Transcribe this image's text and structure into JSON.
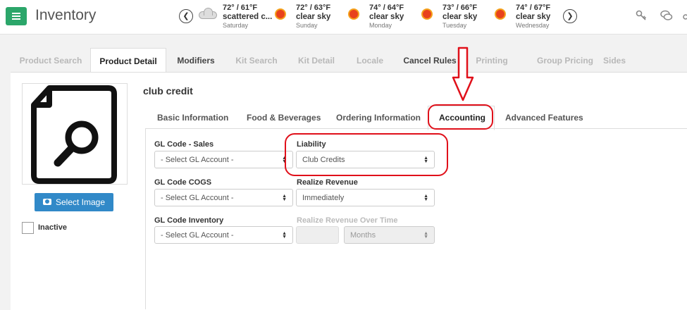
{
  "app": {
    "title": "Inventory"
  },
  "weather": [
    {
      "temp": "72° / 61°F",
      "cond": "scattered c...",
      "day": "Saturday",
      "icon": "cloud-icon"
    },
    {
      "temp": "72° / 63°F",
      "cond": "clear sky",
      "day": "Sunday",
      "icon": "sun-icon"
    },
    {
      "temp": "74° / 64°F",
      "cond": "clear sky",
      "day": "Monday",
      "icon": "sun-icon"
    },
    {
      "temp": "73° / 66°F",
      "cond": "clear sky",
      "day": "Tuesday",
      "icon": "sun-icon"
    },
    {
      "temp": "74° / 67°F",
      "cond": "clear sky",
      "day": "Wednesday",
      "icon": "sun-icon"
    }
  ],
  "tabs": [
    "Product Search",
    "Product Detail",
    "Modifiers",
    "Kit Search",
    "Kit Detail",
    "Locale",
    "Cancel Rules",
    "Printing",
    "Group Pricing",
    "Sides"
  ],
  "image": {
    "button": "Select Image",
    "inactive_label": "Inactive"
  },
  "item": {
    "title": "club credit"
  },
  "subtabs": [
    "Basic Information",
    "Food & Beverages",
    "Ordering Information",
    "Accounting",
    "Advanced Features"
  ],
  "form": {
    "gl_sales": {
      "label": "GL Code - Sales",
      "value": "- Select GL Account -"
    },
    "liability": {
      "label": "Liability",
      "value": "Club Credits"
    },
    "gl_cogs": {
      "label": "GL Code COGS",
      "value": "- Select GL Account -"
    },
    "realize_revenue": {
      "label": "Realize Revenue",
      "value": "Immediately"
    },
    "gl_inventory": {
      "label": "GL Code Inventory",
      "value": "- Select GL Account -"
    },
    "realize_over_time": {
      "label": "Realize Revenue Over Time",
      "value": "",
      "unit": "Months"
    }
  },
  "colors": {
    "brand": "#2ba66a",
    "primary_button": "#3189c8",
    "annotation": "#e0101a"
  }
}
